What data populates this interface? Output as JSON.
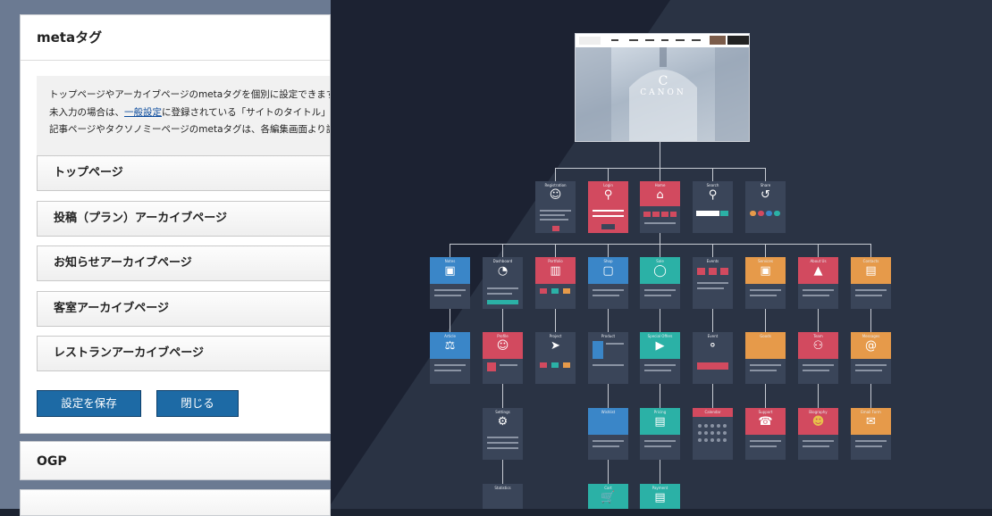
{
  "meta_panel": {
    "title": "metaタグ",
    "desc_line1": "トップページやアーカイブページのmetaタグを個別に設定できます。",
    "desc_line2_a": "未入力の場合は、",
    "desc_line2_link": "一般設定",
    "desc_line2_b": "に登録されている「サイトのタイトル」と「キ",
    "desc_line3": "記事ページやタクソノミーページのmetaタグは、各編集画面より設定で",
    "sections": [
      "トップページ",
      "投稿（プラン）アーカイブページ",
      "お知らせアーカイブページ",
      "客室アーカイブページ",
      "レストランアーカイブページ"
    ],
    "save_label": "設定を保存",
    "close_label": "閉じる"
  },
  "ogp_panel": {
    "title": "OGP"
  },
  "sitemap": {
    "screenshot_logo": "CANON",
    "screenshot_logo_mark": "C",
    "screenshot_nav_items": [
      "HOME",
      "ROOMS",
      "DINING",
      "PLAN",
      "ACCESS",
      "CONTACT"
    ],
    "level1": [
      "Registration",
      "Login",
      "Home",
      "Search",
      "Share"
    ],
    "level2": [
      "Notes",
      "Dashboard",
      "Portfolio",
      "Shop",
      "Sale",
      "Events",
      "Services",
      "About Us",
      "Contacts"
    ],
    "level3": [
      "Article",
      "Profile",
      "Project",
      "Product",
      "Special Offers",
      "Event",
      "Goods",
      "Team",
      "Messages"
    ],
    "level4": [
      "Settings",
      "Wishlist",
      "Pricing",
      "Calendar",
      "Support",
      "Biography",
      "Email Form"
    ],
    "level5": [
      "Statistics",
      "Cart",
      "Payment"
    ]
  },
  "colors": {
    "accent_blue": "#1d6aa5",
    "card_red": "#d24a5f",
    "card_teal": "#2bb1a6",
    "card_blue": "#3a86c8",
    "card_orange": "#e69a4a",
    "card_dark": "#3a4559"
  }
}
